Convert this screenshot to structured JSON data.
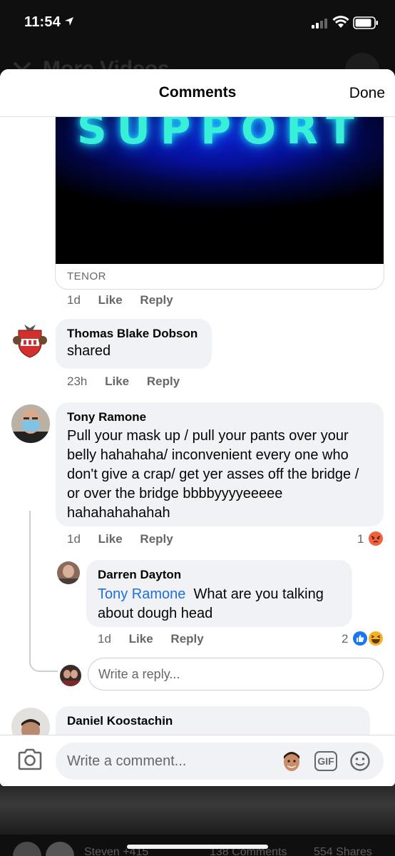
{
  "status": {
    "time": "11:54"
  },
  "background": {
    "title": "More Videos",
    "footer_names": "Steven +415",
    "footer_comments": "138 Comments",
    "footer_shares": "554 Shares"
  },
  "sheet": {
    "title": "Comments",
    "done_label": "Done"
  },
  "gif": {
    "text": "SUPPORT",
    "provider": "TENOR",
    "meta": {
      "time": "1d",
      "like": "Like",
      "reply": "Reply"
    }
  },
  "comments": [
    {
      "author": "Thomas Blake Dobson",
      "text": "shared",
      "meta": {
        "time": "23h",
        "like": "Like",
        "reply": "Reply"
      }
    },
    {
      "author": "Tony Ramone",
      "text": "Pull your mask up / pull your pants over your belly hahahaha/ inconvenient every one who don't give a crap/ get yer asses off the bridge / or over the bridge bbbbyyyyeeeee hahahahahahah",
      "meta": {
        "time": "1d",
        "like": "Like",
        "reply": "Reply"
      },
      "reaction_count": "1",
      "reactions": [
        "angry-icon"
      ],
      "replies": [
        {
          "author": "Darren Dayton",
          "mention": "Tony Ramone",
          "text": "What are you talking about dough head",
          "meta": {
            "time": "1d",
            "like": "Like",
            "reply": "Reply"
          },
          "reaction_count": "2",
          "reactions": [
            "like-icon",
            "haha-icon"
          ]
        }
      ],
      "reply_placeholder": "Write a reply..."
    },
    {
      "author": "Daniel Koostachin"
    }
  ],
  "composer": {
    "placeholder": "Write a comment...",
    "gif_label": "GIF",
    "icons": [
      "camera-icon",
      "avatar-sticker-icon",
      "gif-icon",
      "emoji-icon"
    ]
  },
  "colors": {
    "bubble": "#f0f2f5",
    "mention": "#216fdb",
    "meta": "#65676b",
    "like_blue": "#1877f2",
    "angry_orange": "#f0623f"
  }
}
